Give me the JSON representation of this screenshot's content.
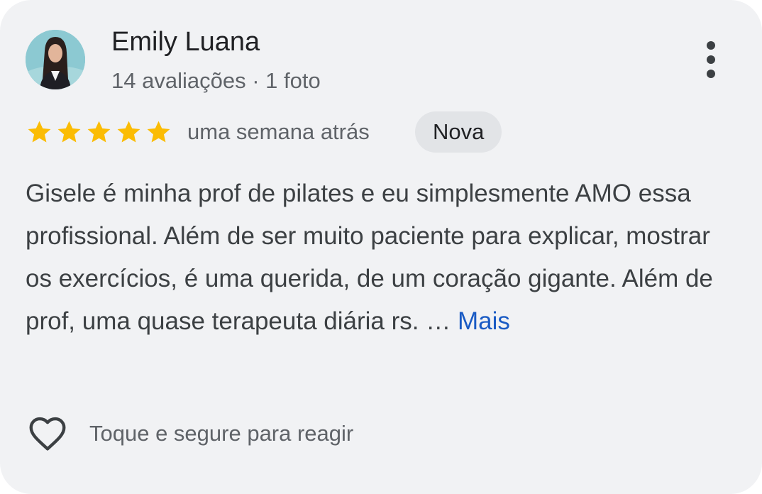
{
  "reviewer": {
    "name": "Emily Luana",
    "reviews_count": "14 avaliações",
    "separator": "·",
    "photos_count": "1 foto"
  },
  "rating": {
    "stars": 5,
    "max": 5,
    "color": "#fbbc04"
  },
  "time_ago": "uma semana atrás",
  "badge": "Nova",
  "review": {
    "text": "Gisele é minha prof de pilates e eu simplesmente AMO essa profissional. Além de ser muito paciente para explicar, mostrar os exercícios, é uma querida, de um coração gigante. Além de prof, uma quase terapeuta diária rs.",
    "ellipsis": "…",
    "more_label": "Mais"
  },
  "reaction": {
    "icon": "heart-outline-icon",
    "label": "Toque e segure para reagir"
  },
  "menu": {
    "icon": "more-vert-icon"
  },
  "colors": {
    "link": "#1a5bc4",
    "card_bg": "#f1f2f4",
    "badge_bg": "#e2e4e7"
  }
}
